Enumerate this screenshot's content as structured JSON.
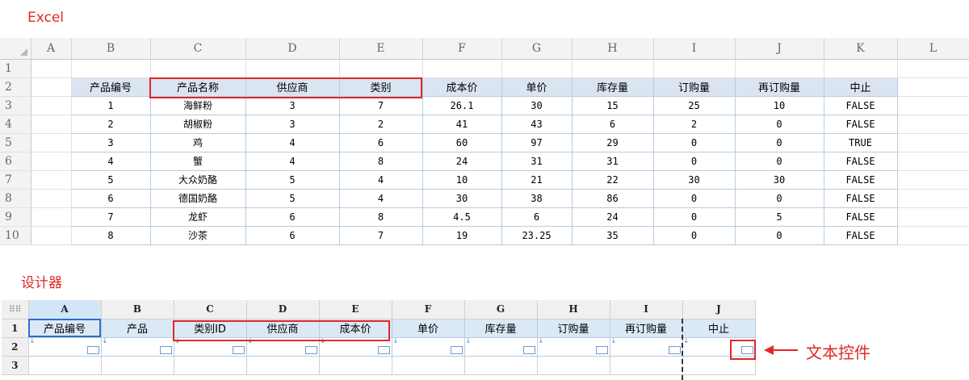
{
  "labels": {
    "excel_title": "Excel",
    "designer_title": "设计器",
    "callout": "文本控件"
  },
  "colors": {
    "accent_red": "#e02828",
    "header_bg": "#dbe5f1",
    "selection_blue": "#2f6fc7"
  },
  "excel": {
    "column_headers": [
      "A",
      "B",
      "C",
      "D",
      "E",
      "F",
      "G",
      "H",
      "I",
      "J",
      "K",
      "L"
    ],
    "row_numbers": [
      "1",
      "2",
      "3",
      "4",
      "5",
      "6",
      "7",
      "8",
      "9",
      "10"
    ],
    "field_headers": [
      "产品编号",
      "产品名称",
      "供应商",
      "类别",
      "成本价",
      "单价",
      "库存量",
      "订购量",
      "再订购量",
      "中止"
    ],
    "rows": [
      [
        "1",
        "海鲜粉",
        "3",
        "7",
        "26.1",
        "30",
        "15",
        "25",
        "10",
        "FALSE"
      ],
      [
        "2",
        "胡椒粉",
        "3",
        "2",
        "41",
        "43",
        "6",
        "2",
        "0",
        "FALSE"
      ],
      [
        "3",
        "鸡",
        "4",
        "6",
        "60",
        "97",
        "29",
        "0",
        "0",
        "TRUE"
      ],
      [
        "4",
        "蟹",
        "4",
        "8",
        "24",
        "31",
        "31",
        "0",
        "0",
        "FALSE"
      ],
      [
        "5",
        "大众奶酪",
        "5",
        "4",
        "10",
        "21",
        "22",
        "30",
        "30",
        "FALSE"
      ],
      [
        "6",
        "德国奶酪",
        "5",
        "4",
        "30",
        "38",
        "86",
        "0",
        "0",
        "FALSE"
      ],
      [
        "7",
        "龙虾",
        "6",
        "8",
        "4.5",
        "6",
        "24",
        "0",
        "5",
        "FALSE"
      ],
      [
        "8",
        "沙茶",
        "6",
        "7",
        "19",
        "23.25",
        "35",
        "0",
        "0",
        "FALSE"
      ]
    ]
  },
  "designer": {
    "corner_icon": "grid-dots-icon",
    "column_headers": [
      "A",
      "B",
      "C",
      "D",
      "E",
      "F",
      "G",
      "H",
      "I",
      "J"
    ],
    "row_numbers": [
      "1",
      "2",
      "3"
    ],
    "field_headers": [
      "产品编号",
      "产品",
      "类别ID",
      "供应商",
      "成本价",
      "单价",
      "库存量",
      "订购量",
      "再订购量",
      "中止"
    ]
  }
}
